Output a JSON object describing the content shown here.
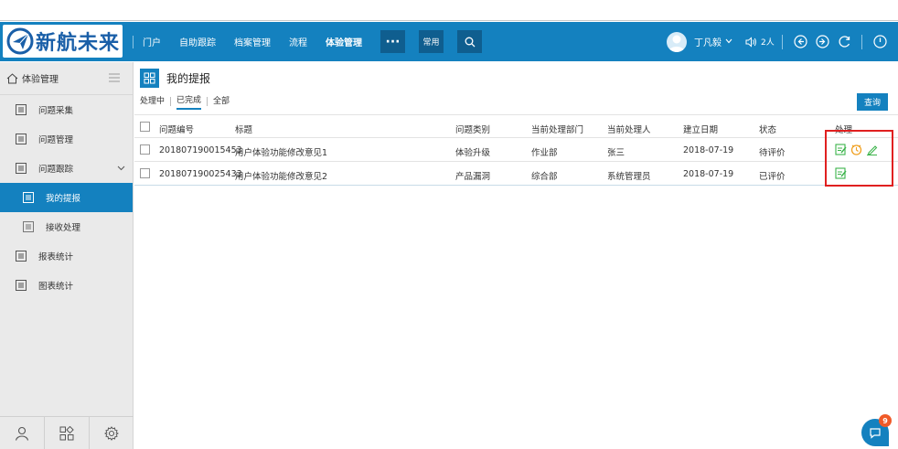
{
  "logo": {
    "text": "新航未来",
    "icon": "paper-plane-logo-icon"
  },
  "nav": {
    "items": [
      "门户",
      "自助跟踪",
      "档案管理",
      "流程",
      "体验管理"
    ],
    "active": "体验管理",
    "more_icon": "ellipsis-icon",
    "common_label": "常用",
    "search_icon": "search-icon"
  },
  "user": {
    "name": "丁凡毅",
    "dropdown_icon": "chevron-down-icon",
    "voice_icon": "speaker-icon",
    "online_count": "2人"
  },
  "toolbar_icons": [
    "back-circle-icon",
    "forward-circle-icon",
    "refresh-icon",
    "power-icon"
  ],
  "sidebar": {
    "header": "体验管理",
    "items": [
      {
        "label": "问题采集",
        "icon": "list-icon"
      },
      {
        "label": "问题管理",
        "icon": "list-icon"
      },
      {
        "label": "问题跟踪",
        "icon": "list-icon"
      },
      {
        "label": "我的提报",
        "icon": "list-icon"
      },
      {
        "label": "接收处理",
        "icon": "list-icon"
      },
      {
        "label": "报表统计",
        "icon": "list-icon"
      },
      {
        "label": "图表统计",
        "icon": "list-icon"
      }
    ],
    "footer_icons": [
      "user-icon",
      "apps-icon",
      "settings-icon"
    ]
  },
  "page": {
    "title": "我的提报",
    "tabs": [
      "处理中",
      "已完成",
      "全部"
    ],
    "active_tab": "已完成",
    "query_label": "查询"
  },
  "table": {
    "headers": [
      "问题编号",
      "标题",
      "问题类别",
      "当前处理部门",
      "当前处理人",
      "建立日期",
      "状态",
      "处理"
    ],
    "rows": [
      {
        "id": "201807190015453",
        "title": "用户体验功能修改意见1",
        "category": "体验升级",
        "dept": "作业部",
        "handler": "张三",
        "date": "2018-07-19",
        "status": "待评价",
        "actions": [
          "evaluate-icon",
          "urge-icon",
          "edit-icon"
        ]
      },
      {
        "id": "201807190025433",
        "title": "用户体验功能修改意见2",
        "category": "产品漏洞",
        "dept": "综合部",
        "handler": "系统管理员",
        "date": "2018-07-19",
        "status": "已评价",
        "actions": [
          "evaluate-icon"
        ]
      }
    ]
  },
  "fab": {
    "badge": "9",
    "icon": "chat-icon"
  },
  "colors": {
    "primary": "#1481bf",
    "highlight": "#e02020",
    "green_icon": "#3bb34a",
    "orange_icon": "#f0a020",
    "badge": "#f05a28"
  }
}
